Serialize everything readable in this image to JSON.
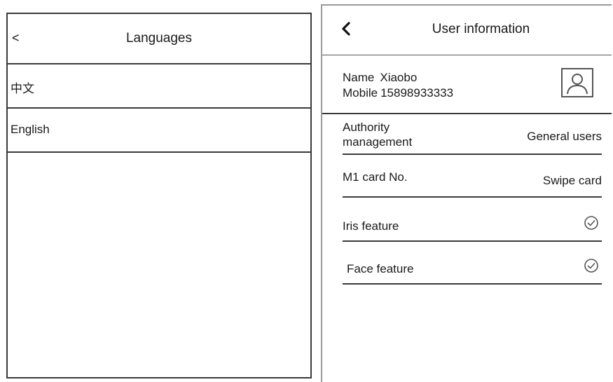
{
  "languages": {
    "back_label": "<",
    "title": "Languages",
    "items": [
      {
        "label": "中文"
      },
      {
        "label": "English"
      }
    ]
  },
  "user_info": {
    "title": "User information",
    "back_icon": "chevron-left-icon",
    "name_label": "Name",
    "name_value": "Xiaobo",
    "mobile_label": "Mobile",
    "mobile_value": "15898933333",
    "avatar_icon": "user-portrait-icon",
    "rows": [
      {
        "label": "Authority management",
        "value": "General users"
      },
      {
        "label": "M1 card No.",
        "value": "Swipe card"
      },
      {
        "label": "Iris feature",
        "icon": "check-circle-icon"
      },
      {
        "label": "Face feature",
        "icon": "check-circle-icon"
      }
    ]
  }
}
